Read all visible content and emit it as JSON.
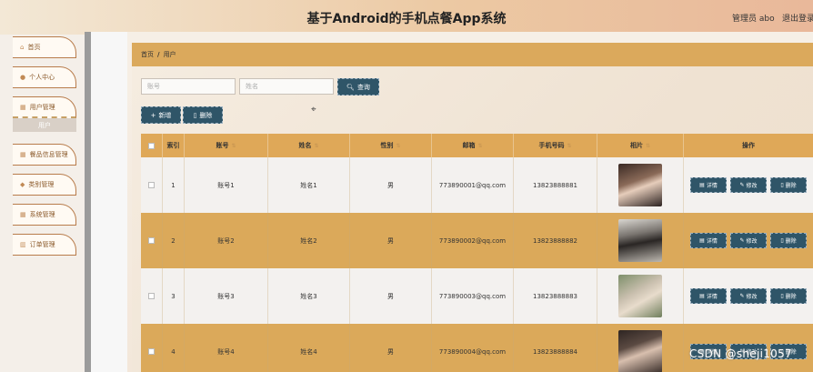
{
  "header": {
    "title": "基于Android的手机点餐App系统",
    "user": "管理员 abo",
    "logout": "退出登录"
  },
  "sidebar": {
    "items": [
      {
        "label": "首页",
        "icon": "home-icon"
      },
      {
        "label": "个人中心",
        "icon": "person-icon"
      },
      {
        "label": "用户管理",
        "icon": "grid-icon"
      },
      {
        "label": "餐品信息管理",
        "icon": "grid-icon"
      },
      {
        "label": "类别管理",
        "icon": "pin-icon"
      },
      {
        "label": "系统管理",
        "icon": "grid-icon"
      },
      {
        "label": "订单管理",
        "icon": "chart-icon"
      }
    ],
    "sub_item": "用户"
  },
  "breadcrumb": {
    "home": "首页",
    "sep": "/",
    "current": "用户"
  },
  "search": {
    "account_placeholder": "账号",
    "name_placeholder": "姓名",
    "button": "查询"
  },
  "actions": {
    "add": "新增",
    "delete": "删除"
  },
  "table": {
    "headers": [
      "索引",
      "账号",
      "姓名",
      "性别",
      "邮箱",
      "手机号码",
      "相片",
      "操作"
    ],
    "rows": [
      {
        "index": "1",
        "account": "账号1",
        "name": "姓名1",
        "gender": "男",
        "email": "773890001@qq.com",
        "phone": "13823888881"
      },
      {
        "index": "2",
        "account": "账号2",
        "name": "姓名2",
        "gender": "男",
        "email": "773890002@qq.com",
        "phone": "13823888882"
      },
      {
        "index": "3",
        "account": "账号3",
        "name": "姓名3",
        "gender": "男",
        "email": "773890003@qq.com",
        "phone": "13823888883"
      },
      {
        "index": "4",
        "account": "账号4",
        "name": "姓名4",
        "gender": "男",
        "email": "773890004@qq.com",
        "phone": "13823888884"
      }
    ],
    "row_actions": {
      "detail": "详情",
      "edit": "修改",
      "delete": "删除"
    }
  },
  "watermark": "CSDN @sheji1057"
}
